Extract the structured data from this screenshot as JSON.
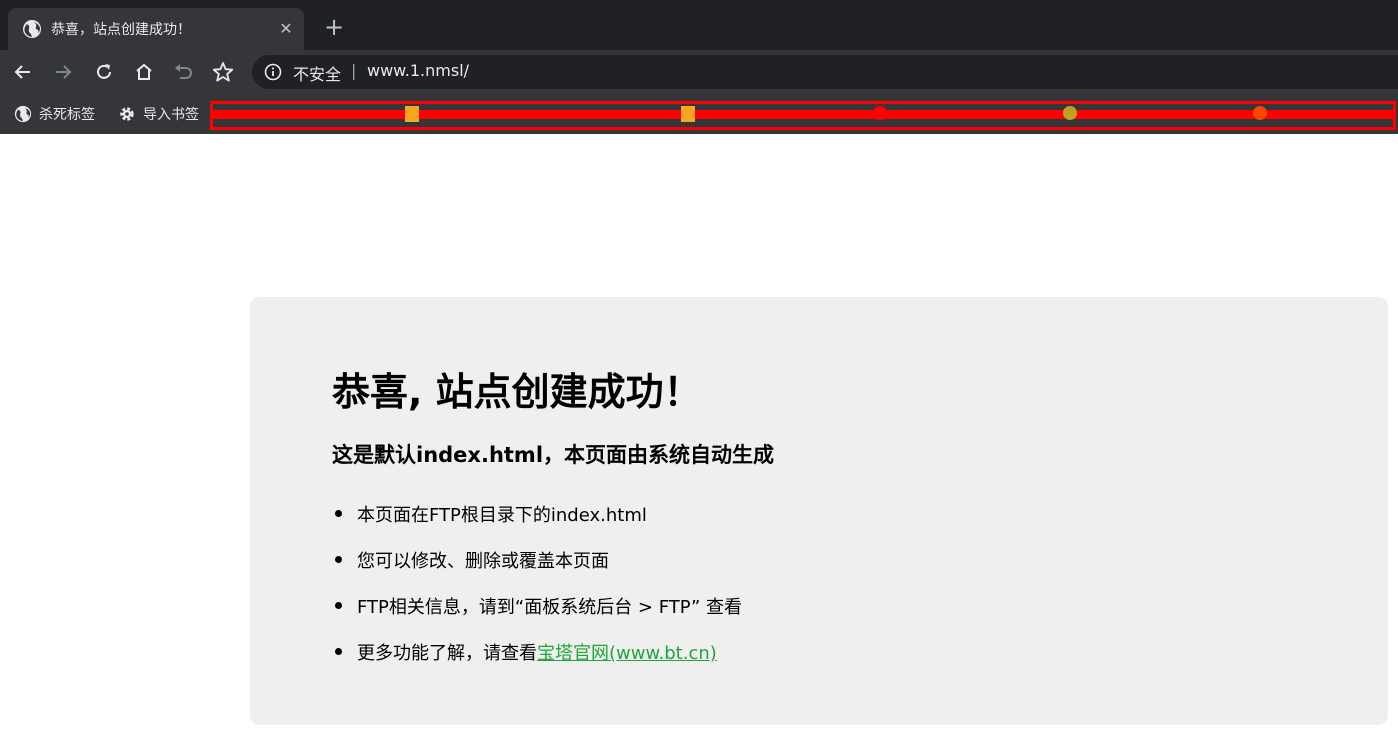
{
  "browser": {
    "tab": {
      "title": "恭喜，站点创建成功！",
      "favicon": "globe-icon",
      "close_label": "✕"
    },
    "new_tab_label": "+",
    "toolbar": {
      "back": "arrow-left-icon",
      "forward": "arrow-right-icon",
      "reload": "reload-icon",
      "home": "home-icon",
      "undo": "undo-icon",
      "bookmark": "star-icon"
    },
    "omnibox": {
      "security_label": "不安全",
      "separator": "|",
      "url": "www.1.nmsl/"
    },
    "bookmarks": [
      {
        "label": "杀死标签",
        "icon": "globe-icon"
      },
      {
        "label": "导入书签",
        "icon": "gear-icon"
      }
    ]
  },
  "page": {
    "heading": "恭喜, 站点创建成功！",
    "subheading": "这是默认index.html，本页面由系统自动生成",
    "items": [
      {
        "text": "本页面在FTP根目录下的index.html"
      },
      {
        "text": "您可以修改、删除或覆盖本页面"
      },
      {
        "text": "FTP相关信息，请到“面板系统后台 > FTP” 查看"
      },
      {
        "text": "更多功能了解，请查看",
        "link": "宝塔官网(www.bt.cn)"
      }
    ],
    "link_color": "#20a53a"
  },
  "colors": {
    "tabstrip": "#202124",
    "toolbar": "#35363a",
    "card_bg": "#efefef",
    "redaction": "#ff0000"
  }
}
